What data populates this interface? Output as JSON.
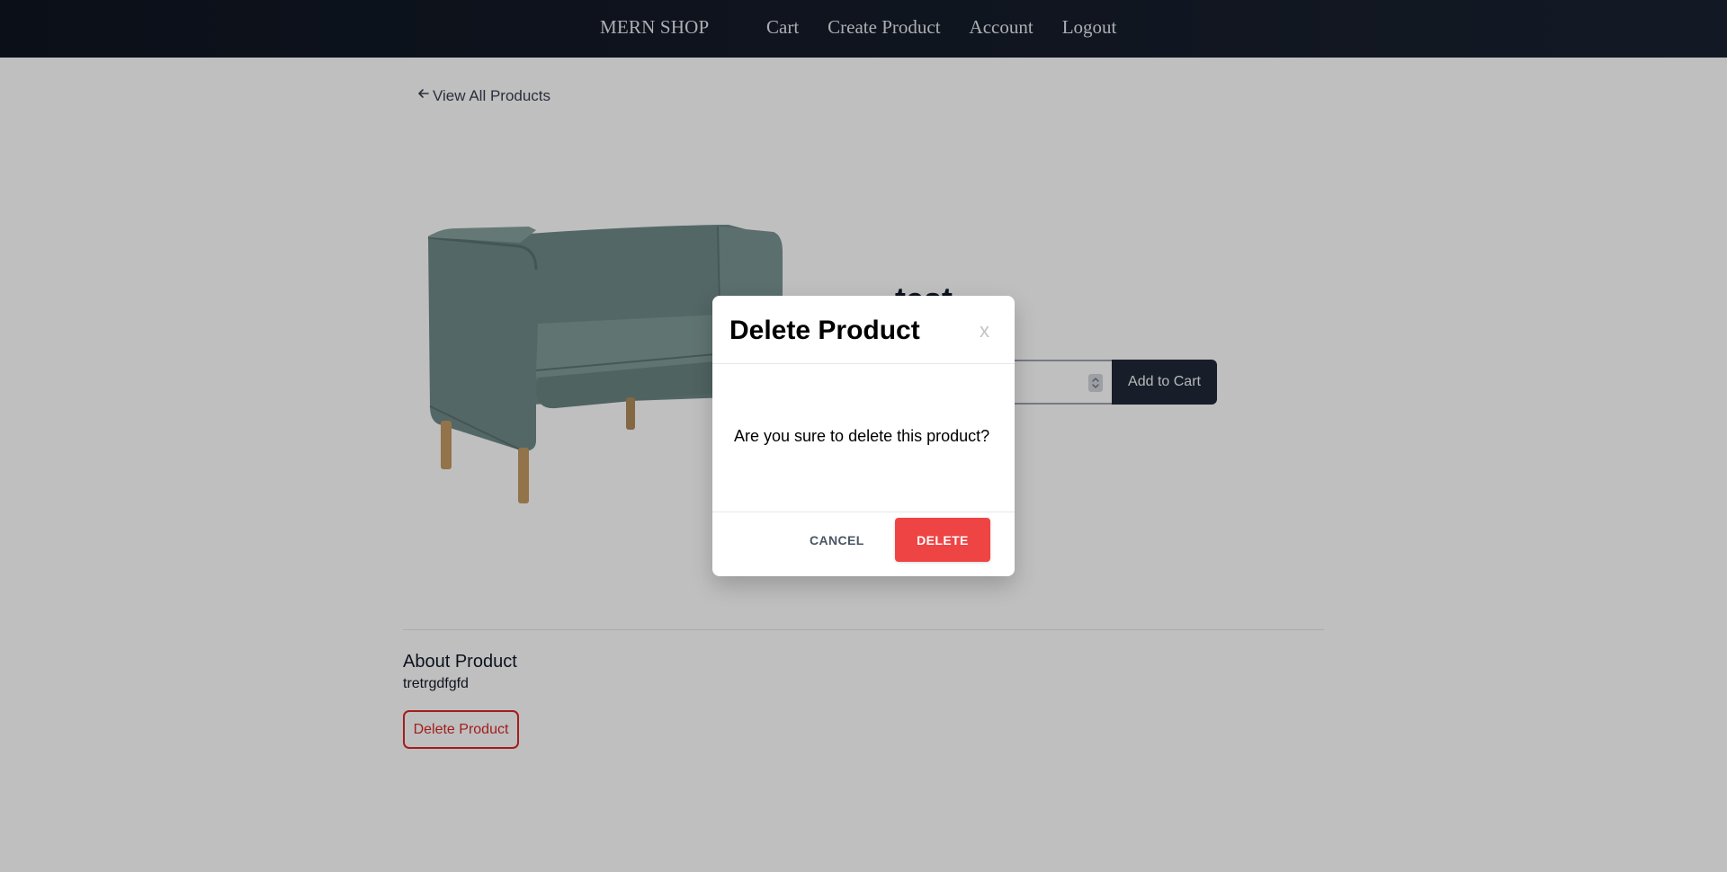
{
  "navbar": {
    "brand": "MERN SHOP",
    "links": [
      "Cart",
      "Create Product",
      "Account",
      "Logout"
    ]
  },
  "page": {
    "back_link": "View All Products",
    "product_title": "test",
    "add_to_cart": "Add to Cart",
    "about_heading": "About Product",
    "about_text": "tretrgdfgfd",
    "delete_product": "Delete Product"
  },
  "modal": {
    "title": "Delete Product",
    "close": "x",
    "message": "Are you sure to delete this product?",
    "cancel": "CANCEL",
    "delete": "DELETE"
  },
  "colors": {
    "navbar": "#0f1521",
    "accent_red": "#ef4444",
    "sofa": "#6f8a88"
  },
  "icons": {
    "back": "arrow-left-icon",
    "spinner": "chevron-updown-icon"
  }
}
